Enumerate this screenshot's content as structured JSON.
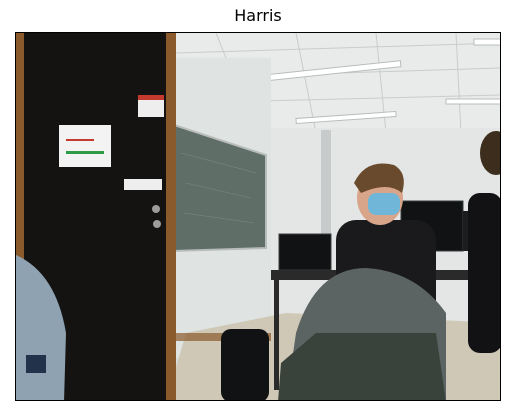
{
  "figure": {
    "title": "Harris"
  },
  "photo": {
    "subject": "classroom-with-student-wearing-mask",
    "palette": {
      "ceiling": "#e9ebea",
      "wall": "#dfe3e2",
      "door": "#141312",
      "door_trim": "#8a5a2c",
      "chalkboard": "#5f6f68",
      "floor": "#cfc8b6",
      "shirt": "#1a1a1c",
      "mask": "#6fb6d9",
      "hair": "#6a4a2c",
      "skin": "#d9a58a",
      "sweater": "#5b6463"
    }
  }
}
